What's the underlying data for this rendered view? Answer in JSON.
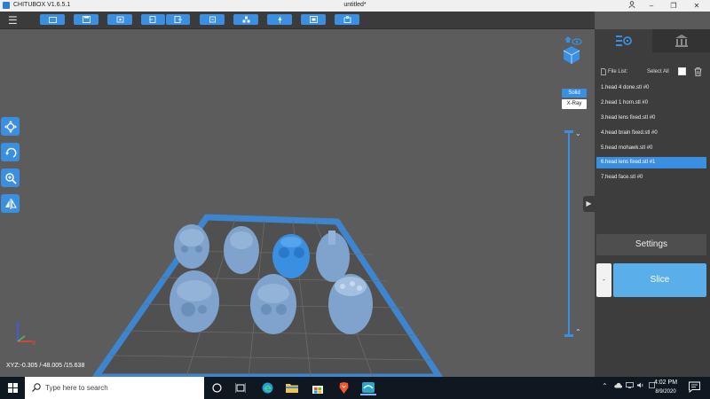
{
  "titlebar": {
    "app_name": "CHITUBOX V1.6.5.1",
    "doc_title": "untitled*",
    "icons": [
      "user-icon",
      "minimize-icon",
      "maximize-icon",
      "close-icon"
    ]
  },
  "toolbar": {
    "menu_icon": "hamburger-menu-icon",
    "buttons": [
      "open-icon",
      "save-icon",
      "screenshot-icon",
      "import-icon",
      "export-icon",
      "duplicate-icon",
      "arrange-icon",
      "support-icon",
      "hollow-icon",
      "dig-hole-icon"
    ]
  },
  "viewport": {
    "left_tools": [
      "move-icon",
      "rotate-icon",
      "scale-icon",
      "mirror-icon"
    ],
    "modes": {
      "solid": "Solid",
      "xray": "X-Ray"
    },
    "coords": "XYZ:-0.305 /-48.005 /15.638",
    "axes": {
      "z": "Z",
      "x": "X"
    }
  },
  "rpanel": {
    "tabs": [
      "slice-settings-icon",
      "resin-library-icon"
    ],
    "file_list_label": "File List:",
    "select_all_label": "Select All",
    "files": [
      "1.head 4 done.stl #0",
      "2.head 1 horn.stl #0",
      "3.head lens fixed.stl #0",
      "4.head brain fixed.stl #0",
      "5.head mohawk.stl #0",
      "6.head lens fixed.stl #1",
      "7.head face.stl #0"
    ],
    "selected_index": 5,
    "settings_label": "Settings",
    "slice_side_label": "-",
    "slice_label": "Slice"
  },
  "taskbar": {
    "search_placeholder": "Type here to search",
    "time": "4:02 PM",
    "date": "8/9/2020",
    "apps": [
      "cortana-icon",
      "task-view-icon",
      "edge-icon",
      "file-explorer-icon",
      "store-icon",
      "brave-icon",
      "chitubox-icon"
    ]
  },
  "colors": {
    "accent": "#3a8fe0",
    "model": "#7fa3cc",
    "selected_model": "#3b8fe0"
  }
}
